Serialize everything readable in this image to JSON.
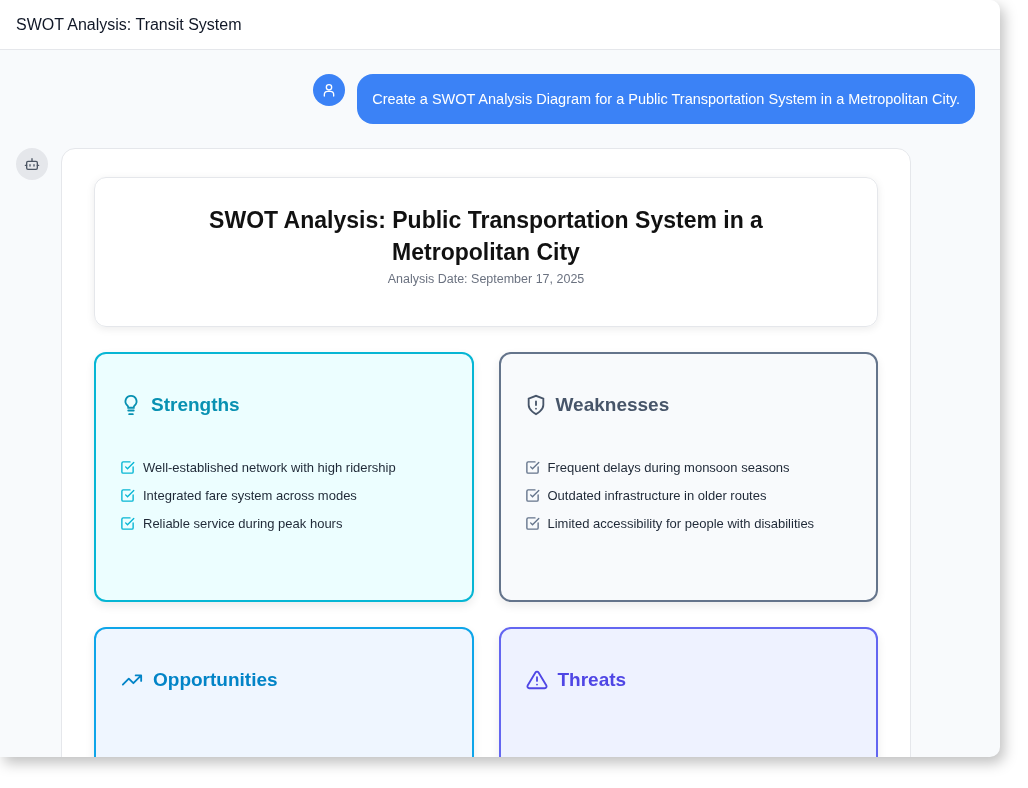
{
  "window": {
    "title": "SWOT Analysis: Transit System"
  },
  "user_message": {
    "text": "Create a SWOT Analysis Diagram for a Public Transportation System in a Metropolitan City."
  },
  "report": {
    "title": "SWOT Analysis: Public Transportation System in a Metropolitan City",
    "date": "Analysis Date: September 17, 2025",
    "quadrants": [
      {
        "kind": "strengths",
        "title": "Strengths",
        "color": "#0891b2",
        "items": [
          "Well-established network with high ridership",
          "Integrated fare system across modes",
          "Reliable service during peak hours"
        ]
      },
      {
        "kind": "weaknesses",
        "title": "Weaknesses",
        "color": "#475569",
        "items": [
          "Frequent delays during monsoon seasons",
          "Outdated infrastructure in older routes",
          "Limited accessibility for people with disabilities"
        ]
      },
      {
        "kind": "opportunities",
        "title": "Opportunities",
        "color": "#0284c7"
      },
      {
        "kind": "threats",
        "title": "Threats",
        "color": "#4f46e5"
      }
    ]
  }
}
